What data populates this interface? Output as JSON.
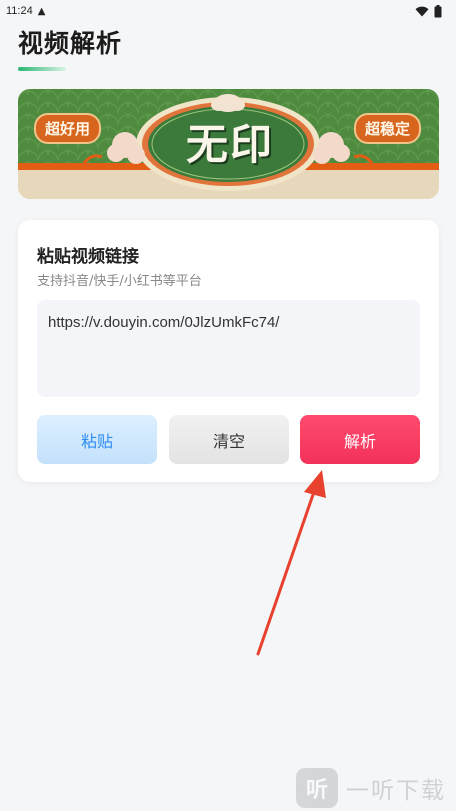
{
  "status_bar": {
    "time": "11:24",
    "android_icon": "android-debug-icon",
    "wifi_icon": "wifi-icon",
    "battery_icon": "battery-icon"
  },
  "header": {
    "title": "视频解析",
    "underline_color": "#2bb673"
  },
  "banner": {
    "badge_left": "超好用",
    "main_text": "无印",
    "badge_right": "超稳定",
    "colors": {
      "green": "#4e8b3f",
      "orange": "#d7651d",
      "cream": "#e7d7bb"
    }
  },
  "card": {
    "title": "粘贴视频链接",
    "subtitle": "支持抖音/快手/小红书等平台",
    "input_value": "https://v.douyin.com/0JlzUmkFc74/",
    "buttons": {
      "paste": "粘贴",
      "clear": "清空",
      "parse": "解析"
    },
    "accent": "#f2315a"
  },
  "annotation": {
    "arrow_color": "#e8412e"
  },
  "watermark": {
    "logo_glyph": "听",
    "text": "一听下载"
  }
}
